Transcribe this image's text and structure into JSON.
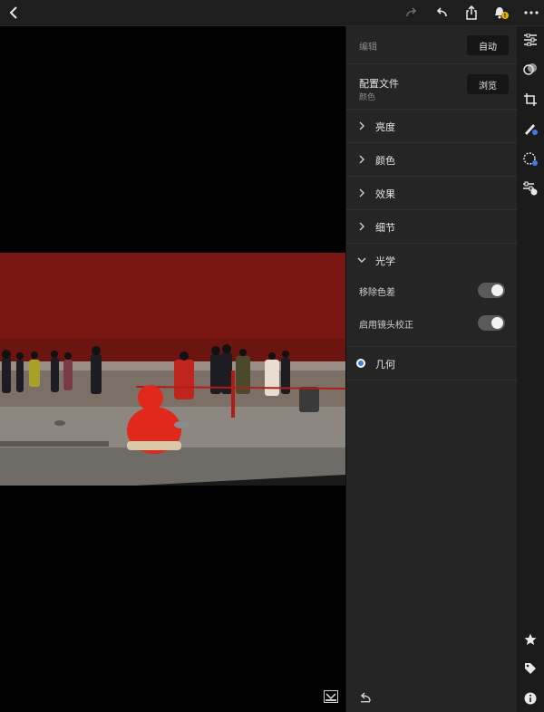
{
  "topbar": {
    "back_icon": "chevron-left-icon",
    "redo_icon": "redo-icon",
    "undo_icon": "undo-icon",
    "share_icon": "share-icon",
    "notify_icon": "bell-icon",
    "more_icon": "more-icon",
    "notification_badge_color": "#e8b400"
  },
  "panel": {
    "edit_label": "编辑",
    "auto_label": "自动",
    "profile_label": "配置文件",
    "profile_value": "颜色",
    "browse_label": "浏览",
    "sections": [
      {
        "label": "亮度",
        "expanded": false
      },
      {
        "label": "颜色",
        "expanded": false
      },
      {
        "label": "效果",
        "expanded": false
      },
      {
        "label": "细节",
        "expanded": false
      },
      {
        "label": "光学",
        "expanded": true
      }
    ],
    "optics": {
      "remove_ca_label": "移除色差",
      "remove_ca_on": true,
      "lens_correction_label": "启用镜头校正",
      "lens_correction_on": true
    },
    "geometry_label": "几何",
    "geometry_dot_color": "#3b7de0"
  },
  "rail": {
    "icons": [
      "sliders-icon",
      "presets-icon",
      "crop-icon",
      "healing-brush-icon",
      "selective-icon",
      "versions-icon",
      "star-icon",
      "tag-icon",
      "info-icon"
    ]
  },
  "colors": {
    "panel_bg": "#252525",
    "topbar_bg": "#1e1e1e",
    "wall_red": "#7a1712",
    "jacket_red": "#e0281c"
  }
}
